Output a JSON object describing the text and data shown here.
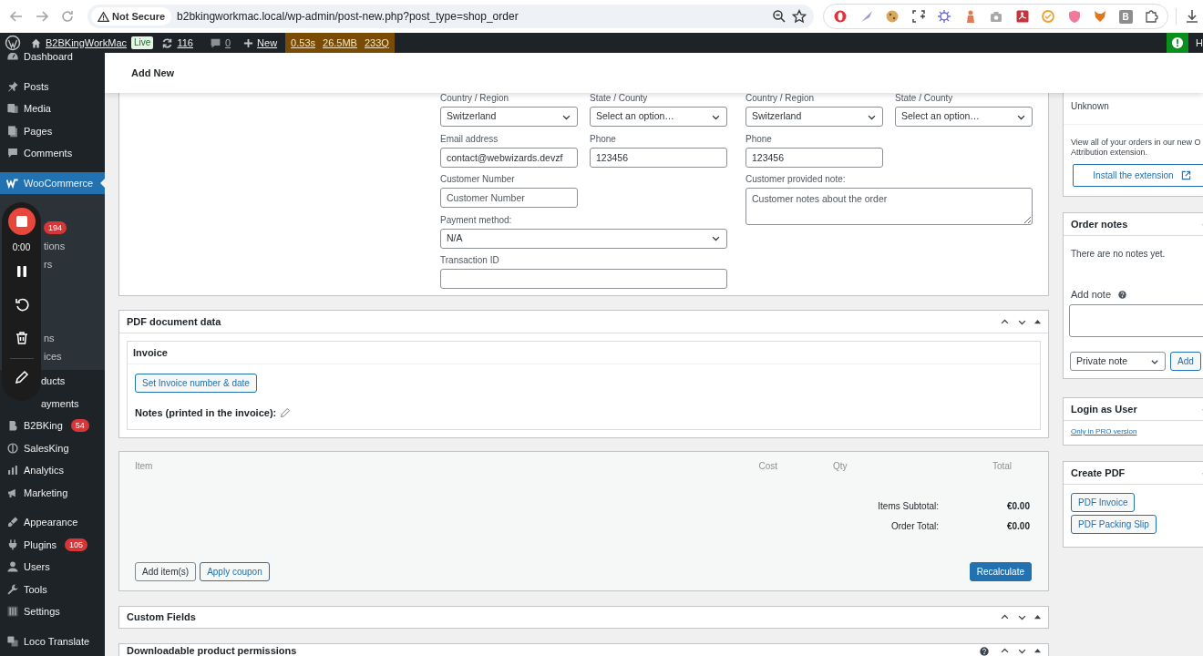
{
  "browser": {
    "security_label": "Not Secure",
    "url": "b2bkingworkmac.local/wp-admin/post-new.php?post_type=shop_order",
    "extension_letter": "B"
  },
  "admin_bar": {
    "site_name": "B2BKingWorkMac",
    "environment": "Live",
    "updates": "116",
    "comments": "0",
    "new_label": "New",
    "stats": [
      "0.53s",
      "26.5MB",
      "233Q"
    ],
    "edge_text": "H"
  },
  "sidebar": {
    "groups": [
      [
        {
          "label": "Dashboard",
          "kind": "menu",
          "selected": false
        }
      ],
      [
        {
          "label": "Posts",
          "kind": "menu",
          "selected": false
        },
        {
          "label": "Media",
          "kind": "menu",
          "selected": false
        },
        {
          "label": "Pages",
          "kind": "menu",
          "selected": false
        },
        {
          "label": "Comments",
          "kind": "menu",
          "selected": false
        }
      ],
      [
        {
          "label": "WooCommerce",
          "kind": "menu",
          "selected": true,
          "children": [
            {
              "badge": "194"
            },
            {
              "label": "tions"
            },
            {
              "label": "rs"
            },
            {
              "label": "ns"
            },
            {
              "label": "ices"
            }
          ]
        },
        {
          "label": "ducts",
          "kind": "partial",
          "selected": false
        },
        {
          "label": "ayments",
          "kind": "partial",
          "selected": false
        },
        {
          "label": "B2BKing",
          "kind": "menu",
          "selected": false,
          "badge": "54"
        },
        {
          "label": "SalesKing",
          "kind": "menu",
          "selected": false
        },
        {
          "label": "Analytics",
          "kind": "menu",
          "selected": false
        },
        {
          "label": "Marketing",
          "kind": "menu",
          "selected": false
        }
      ],
      [
        {
          "label": "Appearance",
          "kind": "menu",
          "selected": false
        },
        {
          "label": "Plugins",
          "kind": "menu",
          "selected": false,
          "badge": "105"
        },
        {
          "label": "Users",
          "kind": "menu",
          "selected": false
        },
        {
          "label": "Tools",
          "kind": "menu",
          "selected": false
        },
        {
          "label": "Settings",
          "kind": "menu",
          "selected": false
        }
      ],
      [
        {
          "label": "Loco Translate",
          "kind": "menu",
          "selected": false
        }
      ]
    ]
  },
  "recorder": {
    "time": "0:00"
  },
  "page_header": {
    "title": "Add New"
  },
  "order_data": {
    "billing": {
      "fields": [
        {
          "label": "Country / Region",
          "kind": "select",
          "value": "Switzerland"
        },
        {
          "label": "State / County",
          "kind": "select",
          "value": "Select an option…"
        },
        {
          "label": "Email address",
          "kind": "input",
          "value": "contact@webwizards.devzf"
        },
        {
          "label": "Phone",
          "kind": "input",
          "value": "123456"
        },
        {
          "label": "Customer Number",
          "kind": "input",
          "placeholder": "Customer Number"
        },
        {
          "label": "Payment method:",
          "kind": "select",
          "value": "N/A",
          "wide": true
        },
        {
          "label": "Transaction ID",
          "kind": "input",
          "wide": true
        }
      ]
    },
    "shipping": {
      "fields": [
        {
          "label": "Country / Region",
          "kind": "select",
          "value": "Switzerland"
        },
        {
          "label": "State / County",
          "kind": "select",
          "value": "Select an option…"
        },
        {
          "label": "Phone",
          "kind": "input",
          "value": "123456"
        },
        {
          "label": "Customer provided note:",
          "kind": "textarea",
          "placeholder": "Customer notes about the order",
          "wide": true
        }
      ]
    }
  },
  "pdf_document": {
    "title": "PDF document data",
    "invoice": {
      "title": "Invoice",
      "button": "Set Invoice number & date",
      "notes_label": "Notes (printed in the invoice):"
    }
  },
  "items": {
    "columns": [
      "Item",
      "Cost",
      "Qty",
      "Total"
    ],
    "totals": [
      {
        "label": "Items Subtotal:",
        "value": "€0.00"
      },
      {
        "label": "Order Total:",
        "value": "€0.00"
      }
    ],
    "buttons": [
      {
        "label": "Add item(s)",
        "kind": "default"
      },
      {
        "label": "Apply coupon",
        "kind": "link"
      },
      {
        "label": "Recalculate",
        "kind": "primary"
      }
    ]
  },
  "panels": [
    {
      "title": "Custom Fields",
      "help": false
    },
    {
      "title": "Downloadable product permissions",
      "help": true
    }
  ],
  "side": {
    "attribution": {
      "origin_value": "Unknown",
      "text_lines": [
        "View all of your orders in our new O",
        "Attribution extension."
      ],
      "button": "Install the extension"
    },
    "order_notes": {
      "title": "Order notes",
      "empty_text": "There are no notes yet.",
      "add_label": "Add note",
      "note_type": "Private note",
      "add_button": "Add"
    },
    "login_as_user": {
      "title": "Login as User",
      "link": "Only in PRO version"
    },
    "create_pdf": {
      "title": "Create PDF",
      "buttons": [
        "PDF Invoice",
        "PDF Packing Slip"
      ]
    }
  }
}
